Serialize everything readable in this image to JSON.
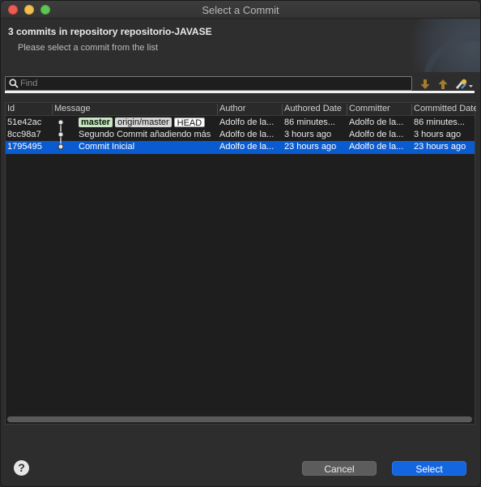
{
  "window": {
    "title": "Select a Commit"
  },
  "header": {
    "title": "3 commits in repository repositorio-JAVASE",
    "subtitle": "Please select a commit from the list"
  },
  "search": {
    "placeholder": "Find",
    "value": ""
  },
  "toolbar": {
    "icons": [
      "arrow-down-icon",
      "arrow-up-icon",
      "filter-icon"
    ]
  },
  "table": {
    "columns": [
      "Id",
      "Message",
      "Author",
      "Authored Date",
      "Committer",
      "Committed Date"
    ],
    "rows": [
      {
        "id": "51e42ac",
        "refs": [
          "master",
          "origin/master",
          "HEAD"
        ],
        "message": "",
        "author": "Adolfo de la...",
        "authored_date": "86 minutes...",
        "committer": "Adolfo de la...",
        "committed_date": "86 minutes...",
        "selected": false
      },
      {
        "id": "8cc98a7",
        "refs": [],
        "message": "Segundo Commit añadiendo más",
        "author": "Adolfo de la...",
        "authored_date": "3 hours ago",
        "committer": "Adolfo de la...",
        "committed_date": "3 hours ago",
        "selected": false
      },
      {
        "id": "1795495",
        "refs": [],
        "message": "Commit Inicial",
        "author": "Adolfo de la...",
        "authored_date": "23 hours ago",
        "committer": "Adolfo de la...",
        "committed_date": "23 hours ago",
        "selected": true
      }
    ]
  },
  "footer": {
    "help_label": "?",
    "cancel_label": "Cancel",
    "select_label": "Select"
  },
  "colors": {
    "selection": "#0b5bd0",
    "primary_button": "#1465e0",
    "tag_master": "#c7e6c2"
  }
}
